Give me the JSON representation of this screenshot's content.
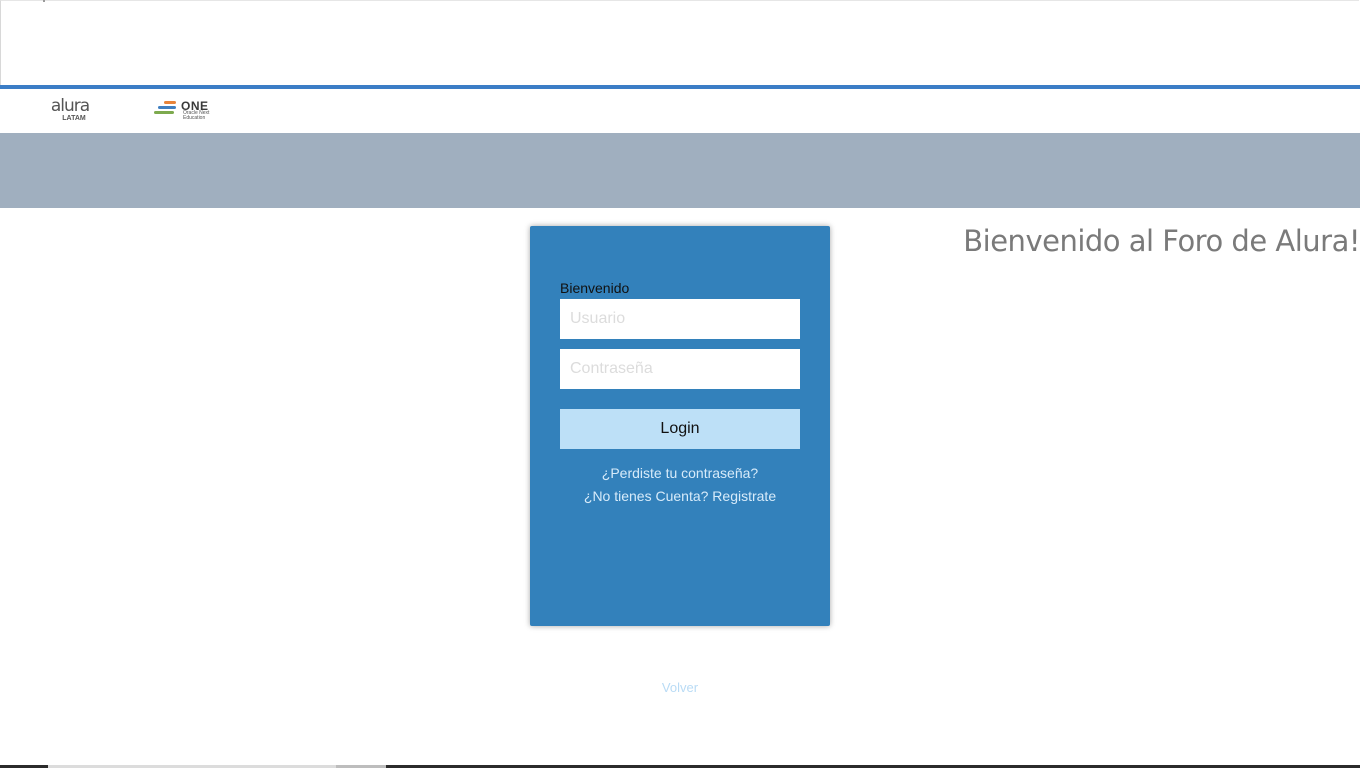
{
  "branding": {
    "alura_word": "alura",
    "alura_sub": "LATAM",
    "one_word": "ONE",
    "one_sub": "Oracle Next Education"
  },
  "main": {
    "heading": "Bienvenido al Foro de Alura!"
  },
  "login": {
    "label": "Bienvenido",
    "username_placeholder": "Usuario",
    "password_placeholder": "Contraseña",
    "button_label": "Login",
    "forgot_link": "¿Perdiste tu contraseña?",
    "register_link": "¿No tienes Cuenta? Registrate"
  },
  "footer": {
    "back_link": "Volver"
  },
  "colors": {
    "accent_rule": "#3b7dc6",
    "band": "#a0afbf",
    "card": "#3381bb",
    "button": "#bde0f7"
  }
}
